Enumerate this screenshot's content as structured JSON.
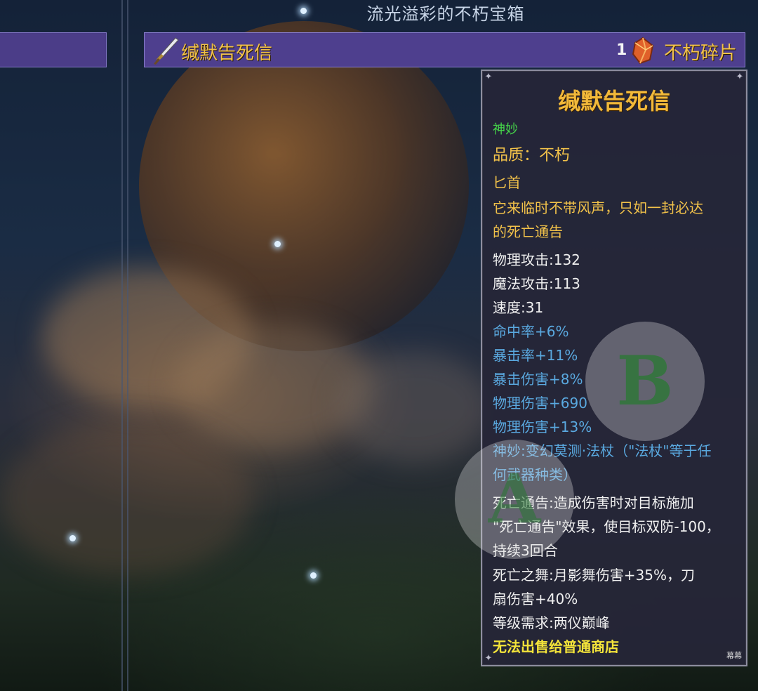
{
  "header": {
    "title": "流光溢彩的不朽宝箱"
  },
  "item_bar": {
    "item_name": "缄默告死信",
    "reward_quantity": "1",
    "reward_name": "不朽碎片",
    "item_icon": "dagger-icon",
    "reward_icon": "gem-fragment-icon"
  },
  "tooltip": {
    "title": "缄默告死信",
    "rarity": "神妙",
    "quality": "品质：不朽",
    "weapon_type": "匕首",
    "description_lines": [
      "它来临时不带风声，只如一封必达",
      "的死亡通告"
    ],
    "base_stats": [
      "物理攻击:132",
      "魔法攻击:113",
      "速度:31"
    ],
    "bonus_stats": [
      "命中率+6%",
      "暴击率+11%",
      "暴击伤害+8%",
      "物理伤害+690",
      "物理伤害+13%"
    ],
    "effects": [
      "神妙:变幻莫测·法杖（\"法杖\"等于任",
      "何武器种类）",
      "死亡通告:造成伤害时对目标施加",
      "\"死亡通告\"效果，使目标双防-100，",
      "持续3回合",
      "死亡之舞:月影舞伤害+35%，刀",
      "扇伤害+40%"
    ],
    "level_requirement": "等级需求:两仪巅峰",
    "sell_note": "无法出售给普通商店",
    "signature": "幕幕"
  },
  "controls": {
    "b_button": "B",
    "a_button": "A"
  },
  "colors": {
    "gold": "#f2c24a",
    "green": "#46d84a",
    "blue": "#5aa9e0",
    "yellow": "#f4e43a",
    "bar_purple": "#4e3f8e",
    "panel_bg": "#262638"
  }
}
